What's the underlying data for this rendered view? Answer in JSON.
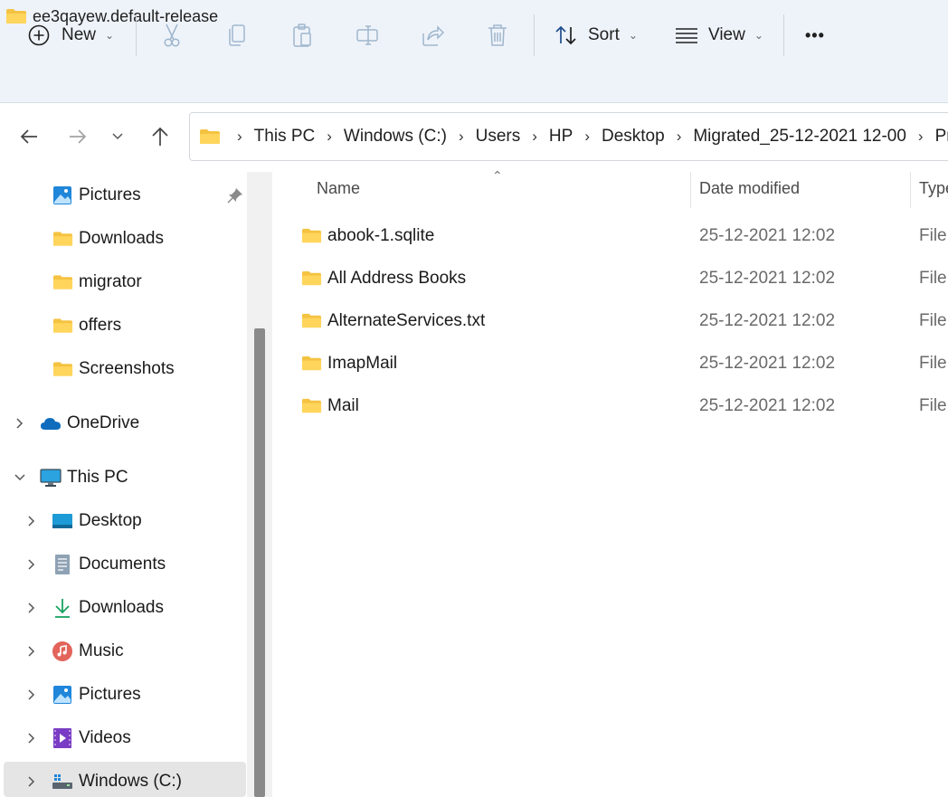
{
  "window": {
    "title": "ee3qayew.default-release"
  },
  "toolbar": {
    "new_label": "New",
    "sort_label": "Sort",
    "view_label": "View",
    "more_label": "•••"
  },
  "address": {
    "crumbs": [
      "This PC",
      "Windows (C:)",
      "Users",
      "HP",
      "Desktop",
      "Migrated_25-12-2021 12-00",
      "Profiles"
    ]
  },
  "sidebar": {
    "quick_access": [
      "Pictures",
      "Downloads",
      "migrator",
      "offers",
      "Screenshots"
    ],
    "onedrive": "OneDrive",
    "this_pc": "This PC",
    "this_pc_items": [
      "Desktop",
      "Documents",
      "Downloads",
      "Music",
      "Pictures",
      "Videos",
      "Windows (C:)"
    ]
  },
  "columns": {
    "name": "Name",
    "date": "Date modified",
    "type": "Type"
  },
  "files": [
    {
      "name": "abook-1.sqlite",
      "date": "25-12-2021 12:02",
      "type": "File"
    },
    {
      "name": "All Address Books",
      "date": "25-12-2021 12:02",
      "type": "File"
    },
    {
      "name": "AlternateServices.txt",
      "date": "25-12-2021 12:02",
      "type": "File"
    },
    {
      "name": "ImapMail",
      "date": "25-12-2021 12:02",
      "type": "File"
    },
    {
      "name": "Mail",
      "date": "25-12-2021 12:02",
      "type": "File"
    }
  ],
  "colors": {
    "folder": "#f5c342",
    "chrome_bg": "#eef3fa",
    "selected": "#e5e5e5",
    "accent": "#0067c0"
  },
  "icons": {
    "title": "folder-icon",
    "new": "plus-circle-icon",
    "cut": "scissors-icon",
    "copy": "copy-icon",
    "paste": "clipboard-icon",
    "rename": "rename-icon",
    "share": "share-icon",
    "delete": "trash-icon",
    "sort": "sort-arrows-icon",
    "view": "view-lines-icon"
  }
}
